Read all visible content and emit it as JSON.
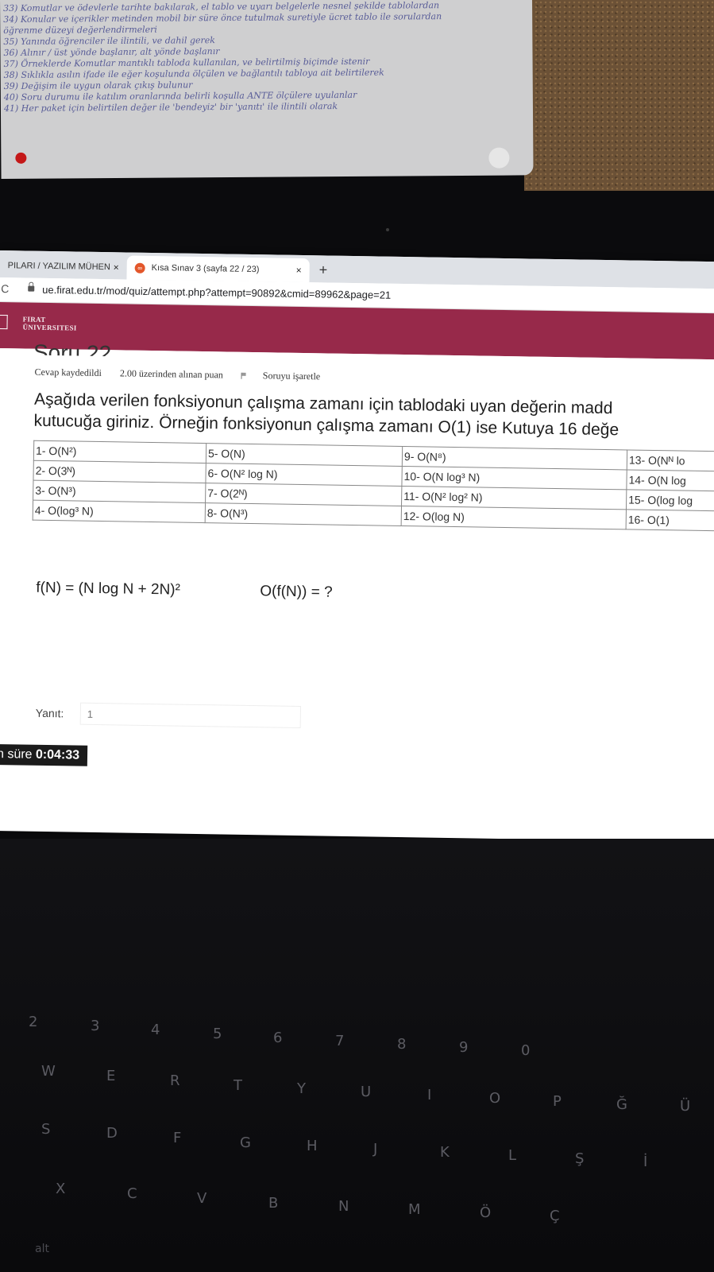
{
  "notebook": {
    "lines": [
      "33) Komutlar ve ödevlerle tarihte bakılarak, el tablo ve uyarı belgelerle nesnel şekilde tablolardan",
      "34) Konular ve içerikler metinden mobil bir süre önce tutulmak suretiyle ücret tablo ile sorulardan",
      "   öğrenme düzeyi değerlendirmeleri",
      "35) Yanında öğrenciler ile ilintili, ve dahil gerek",
      "36) Alınır / üst yönde başlanır, alt yönde başlanır",
      "37) Örneklerde Komutlar mantıklı tabloda kullanılan, ve belirtilmiş biçimde istenir",
      "38) Sıklıkla asılın ifade ile eğer koşulunda ölçülen ve bağlantılı tabloya ait belirtilerek",
      "39) Değişim ile uygun olarak çıkış bulunur",
      "40) Soru durumu ile katılım oranlarında belirli koşulla ANTE ölçülere uyulanlar",
      "41) Her paket için belirtilen değer ile 'bendeyiz' bir 'yanıtı' ile ilintili olarak"
    ]
  },
  "browser": {
    "tabs": [
      {
        "label": "PILARI / YAZILIM MÜHEN",
        "close": "×"
      },
      {
        "label": "Kısa Sınav 3 (sayfa 22 / 23)",
        "close": "×",
        "active": true
      }
    ],
    "new_tab": "+",
    "reload": "C",
    "url": "ue.firat.edu.tr/mod/quiz/attempt.php?attempt=90892&cmid=89962&page=21"
  },
  "site": {
    "logo_line1": "FIRAT",
    "logo_line2": "ÜNIVERSITESI",
    "brand_color": "#97294a"
  },
  "question": {
    "heading": "Soru 22",
    "status": "Cevap kaydedildi",
    "points": "2.00 üzerinden alınan puan",
    "flag_label": "Soruyu işaretle",
    "text_line1": "Aşağıda verilen fonksiyonun çalışma zamanı için tablodaki uyan değerin madd",
    "text_line2": "kutucuğa giriniz. Örneğin fonksiyonun çalışma zamanı O(1) ise Kutuya 16 değe",
    "table": [
      [
        "1- O(N²)",
        "5- O(N)",
        "9- O(N⁸)",
        "13- O(Nᴺ lo"
      ],
      [
        "2- O(3ᴺ)",
        "6- O(N² log N)",
        "10- O(N log³ N)",
        "14- O(N log"
      ],
      [
        "3- O(N³)",
        "7- O(2ᴺ)",
        "11- O(N² log² N)",
        "15- O(log log"
      ],
      [
        "4- O(log³ N)",
        "8- O(N³)",
        "12- O(log N)",
        "16- O(1)"
      ]
    ],
    "formula": "f(N) = (N log N + 2N)²",
    "target": "O(f(N)) = ?",
    "answer_label": "Yanıt:",
    "answer_value": "1",
    "timer_prefix": "n süre",
    "timer_value": "0:04:33"
  },
  "keyboard": {
    "keys": [
      "2",
      "3",
      "4",
      "5",
      "6",
      "7",
      "8",
      "9",
      "0",
      "W",
      "E",
      "R",
      "T",
      "Y",
      "U",
      "I",
      "O",
      "P",
      "Ğ",
      "Ü",
      "S",
      "D",
      "F",
      "G",
      "H",
      "J",
      "K",
      "L",
      "Ş",
      "İ",
      "X",
      "C",
      "V",
      "B",
      "N",
      "M",
      "Ö",
      "Ç",
      "alt"
    ]
  }
}
